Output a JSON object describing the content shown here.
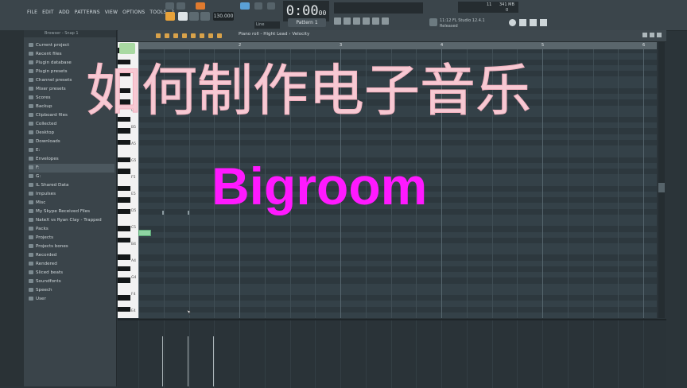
{
  "menu": [
    "FILE",
    "EDIT",
    "ADD",
    "PATTERNS",
    "VIEW",
    "OPTIONS",
    "TOOLS",
    "?"
  ],
  "transport": {
    "tempo": "130.000",
    "time": "0:00",
    "time_small": "00",
    "pattern": "Pattern 1",
    "line_mode": "Line"
  },
  "monitor": {
    "cpu": "11",
    "memory": "341 MB",
    "voices": "0"
  },
  "news": "11:12 FL Studio 12.4.1 Released",
  "browser": {
    "header": "Browser - Snap 1",
    "items": [
      {
        "label": "Current project"
      },
      {
        "label": "Recent files"
      },
      {
        "label": "Plugin database"
      },
      {
        "label": "Plugin presets"
      },
      {
        "label": "Channel presets"
      },
      {
        "label": "Mixer presets"
      },
      {
        "label": "Scores"
      },
      {
        "label": "Backup"
      },
      {
        "label": "Clipboard files"
      },
      {
        "label": "Collected"
      },
      {
        "label": "Desktop"
      },
      {
        "label": "Downloads"
      },
      {
        "label": "E:"
      },
      {
        "label": "Envelopes"
      },
      {
        "label": "F:"
      },
      {
        "label": "G:"
      },
      {
        "label": "IL Shared Data"
      },
      {
        "label": "Impulses"
      },
      {
        "label": "Misc"
      },
      {
        "label": "My Skype Received Files"
      },
      {
        "label": "NateX vs Ryan Clay - Trapped"
      },
      {
        "label": "Packs"
      },
      {
        "label": "Projects"
      },
      {
        "label": "Projects bones"
      },
      {
        "label": "Recorded"
      },
      {
        "label": "Rendered"
      },
      {
        "label": "Sliced beats"
      },
      {
        "label": "Soundfonts"
      },
      {
        "label": "Speech"
      },
      {
        "label": "User"
      }
    ],
    "selected_index": 14
  },
  "piano_roll": {
    "breadcrumb": "Piano roll - Hight Lead › Velocity",
    "bar_numbers": [
      "2",
      "3",
      "4",
      "5",
      "6"
    ],
    "key_labels": [
      "C6",
      "B5",
      "A5",
      "G5",
      "F5",
      "E5",
      "D5",
      "C5",
      "B4",
      "A4",
      "G4",
      "F4",
      "E4",
      "D4",
      "C4"
    ]
  },
  "overlay": {
    "title": "如何制作电子音乐",
    "subtitle": "Bigroom"
  }
}
